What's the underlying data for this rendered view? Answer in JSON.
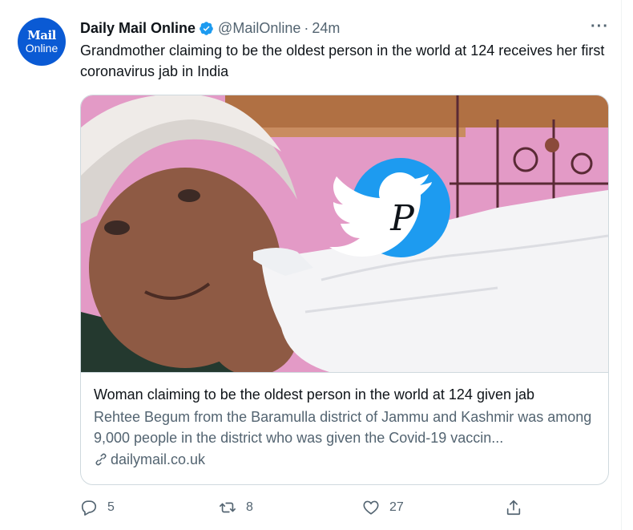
{
  "avatar": {
    "line1": "Mail",
    "line2": "Online"
  },
  "author": {
    "name": "Daily Mail Online",
    "handle": "@MailOnline",
    "separator": "·",
    "time": "24m"
  },
  "more_label": "···",
  "tweet": {
    "text": "Grandmother claiming to be the oldest person in the world at 124 receives her first coronavirus jab in India"
  },
  "card": {
    "title": "Woman claiming to be the oldest person in the world at 124 given jab",
    "description": "Rehtee Begum from the Baramulla district of Jammu and Kashmir was among 9,000 people in the district who was given the Covid-19 vaccin...",
    "domain": "dailymail.co.uk",
    "watermark_letter": "P"
  },
  "actions": {
    "reply_count": "5",
    "retweet_count": "8",
    "like_count": "27"
  },
  "colors": {
    "brand_blue": "#1d9bf0",
    "avatar_blue": "#0a5ad4",
    "secondary_text": "#536471",
    "border": "#cfd9de"
  },
  "icons": [
    "verified-badge-icon",
    "more-icon",
    "link-icon",
    "reply-icon",
    "retweet-icon",
    "like-icon",
    "share-icon",
    "twitter-bird-icon"
  ]
}
